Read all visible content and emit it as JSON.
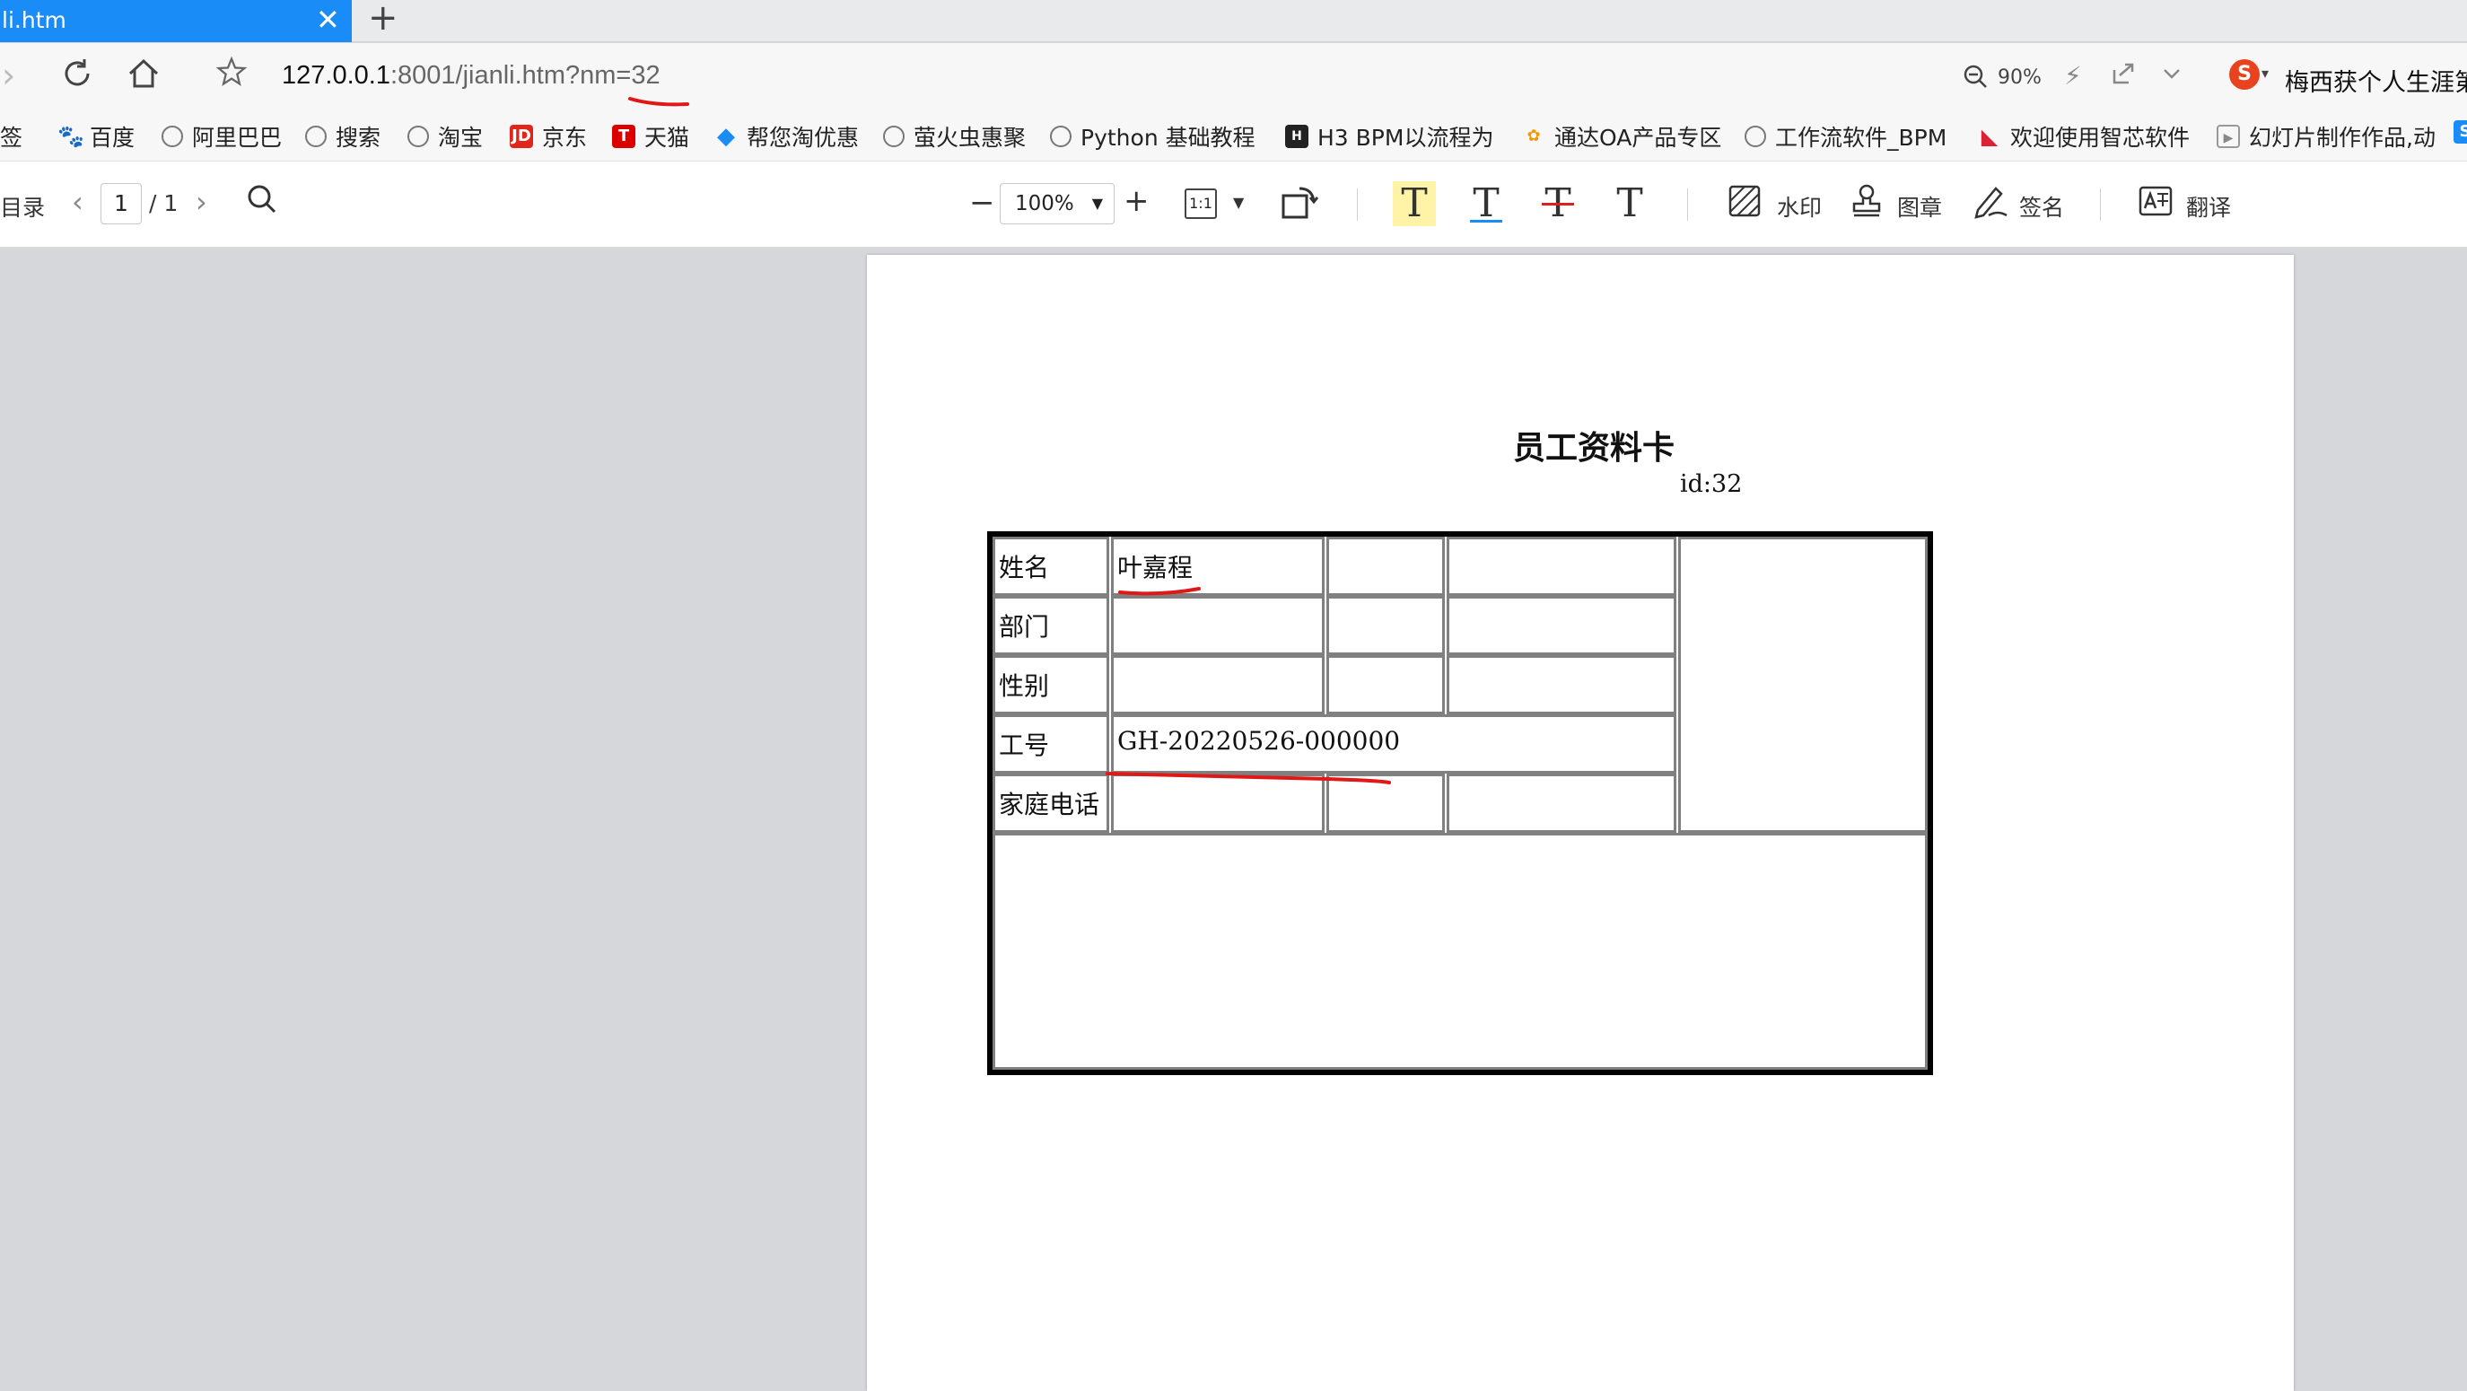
{
  "browser": {
    "tab": {
      "title": "li.htm",
      "close_glyph": "✕"
    },
    "new_tab_glyph": "+",
    "url": {
      "host": "127.0.0.1",
      "rest": ":8001/jianli.htm?nm=32"
    },
    "zoom": "90%",
    "search_box_text": "梅西获个人生涯第",
    "sogou_letter": "S"
  },
  "bookmarks": [
    {
      "label": "签",
      "icon": "none"
    },
    {
      "label": "百度",
      "icon": "baidu-icon"
    },
    {
      "label": "阿里巴巴",
      "icon": "globe-icon"
    },
    {
      "label": "搜索",
      "icon": "globe-icon"
    },
    {
      "label": "淘宝",
      "icon": "globe-icon"
    },
    {
      "label": "京东",
      "icon": "jd-icon"
    },
    {
      "label": "天猫",
      "icon": "tmall-icon"
    },
    {
      "label": "帮您淘优惠",
      "icon": "bang-icon"
    },
    {
      "label": "萤火虫惠聚",
      "icon": "globe-icon"
    },
    {
      "label": "Python 基础教程",
      "icon": "globe-icon"
    },
    {
      "label": "H3 BPM以流程为",
      "icon": "h3-icon"
    },
    {
      "label": "通达OA产品专区",
      "icon": "oa-icon"
    },
    {
      "label": "工作流软件_BPM",
      "icon": "globe-icon"
    },
    {
      "label": "欢迎使用智芯软件",
      "icon": "cn-icon"
    },
    {
      "label": "幻灯片制作作品,动",
      "icon": "ppt-icon"
    }
  ],
  "pdf_toolbar": {
    "toc_label": "目录",
    "current_page": "1",
    "total_pages": "/ 1",
    "zoom": "100%",
    "fit_label": "1:1",
    "watermark_label": "水印",
    "stamp_label": "图章",
    "sign_label": "签名",
    "translate_label": "翻译",
    "text_tool_glyph": "T"
  },
  "document": {
    "title": "员工资料卡",
    "id_text": "id:32",
    "rows": [
      {
        "label": "姓名",
        "value": "叶嘉程"
      },
      {
        "label": "部门",
        "value": ""
      },
      {
        "label": "性别",
        "value": ""
      },
      {
        "label": "工号",
        "value": "GH-20220526-000000"
      },
      {
        "label": "家庭电话",
        "value": ""
      }
    ]
  },
  "colors": {
    "tab_active": "#1a8cf7",
    "annotation_red": "#e01818",
    "highlight_tool": "#fff3a8",
    "viewer_background": "#d6d7db"
  }
}
